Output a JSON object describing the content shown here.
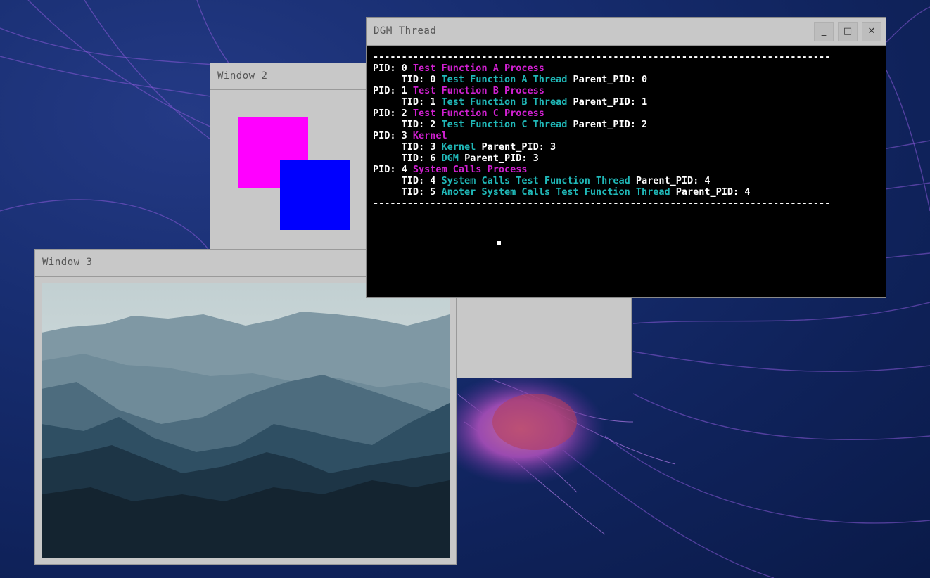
{
  "desktop": {
    "background_color": "#172d70"
  },
  "windows": {
    "window2": {
      "title": "Window 2",
      "shape_colors": [
        "#ff00ff",
        "#0000ff"
      ]
    },
    "window3": {
      "title": "Window 3"
    },
    "dgm_thread": {
      "title": "DGM Thread",
      "controls": {
        "minimize": "_",
        "maximize": "□",
        "close": "✕"
      },
      "colors": {
        "process": "#d020d0",
        "thread": "#20b8b8",
        "text": "#ffffff",
        "background": "#000000"
      },
      "separator": "--------------------------------------------------------------------------------",
      "lines": {
        "l1": {
          "a": "PID: 0 ",
          "b": "Test Function A Process"
        },
        "l2": {
          "a": "     TID: 0 ",
          "b": "Test Function A Thread",
          "c": " Parent_PID: 0"
        },
        "l3": {
          "a": "PID: 1 ",
          "b": "Test Function B Process"
        },
        "l4": {
          "a": "     TID: 1 ",
          "b": "Test Function B Thread",
          "c": " Parent_PID: 1"
        },
        "l5": {
          "a": "PID: 2 ",
          "b": "Test Function C Process"
        },
        "l6": {
          "a": "     TID: 2 ",
          "b": "Test Function C Thread",
          "c": " Parent_PID: 2"
        },
        "l7": {
          "a": "PID: 3 ",
          "b": "Kernel"
        },
        "l8": {
          "a": "     TID: 3 ",
          "b": "Kernel",
          "c": " Parent_PID: 3"
        },
        "l9": {
          "a": "     TID: 6 ",
          "b": "DGM",
          "c": " Parent_PID: 3"
        },
        "l10": {
          "a": "PID: 4 ",
          "b": "System Calls Process"
        },
        "l11": {
          "a": "     TID: 4 ",
          "b": "System Calls Test Function Thread",
          "c": " Parent_PID: 4"
        },
        "l12": {
          "a": "     TID: 5 ",
          "b": "Anoter System Calls Test Function Thread",
          "c": " Parent_PID: 4"
        }
      }
    }
  }
}
